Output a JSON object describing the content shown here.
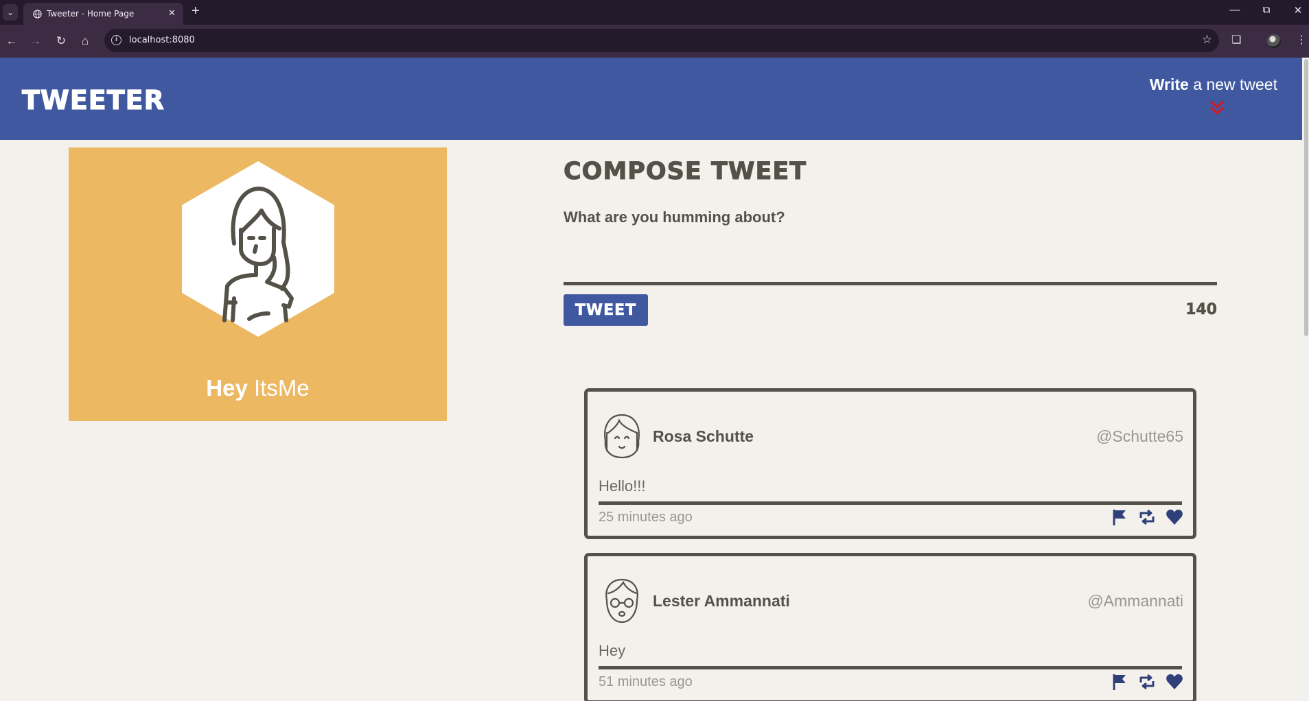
{
  "browser": {
    "tab_title": "Tweeter - Home Page",
    "url": "localhost:8080"
  },
  "header": {
    "logo": "TWEETER",
    "write_bold": "Write",
    "write_rest": " a new tweet"
  },
  "profile": {
    "greeting": "Hey",
    "name": " ItsMe"
  },
  "compose": {
    "title": "Compose Tweet",
    "placeholder": "What are you humming about?",
    "tweet_button": "Tweet",
    "counter": "140"
  },
  "tweets": [
    {
      "name": "Rosa Schutte",
      "handle": "@Schutte65",
      "content": "Hello!!!",
      "time": "25 minutes ago"
    },
    {
      "name": "Lester Ammannati",
      "handle": "@Ammannati",
      "content": "Hey",
      "time": "51 minutes ago"
    }
  ],
  "colors": {
    "brand_blue": "#4058a0",
    "profile_gold": "#ecb862",
    "text_dark": "#545149",
    "accent_red": "#d11a2a",
    "icon_navy": "#2e3f7a"
  }
}
